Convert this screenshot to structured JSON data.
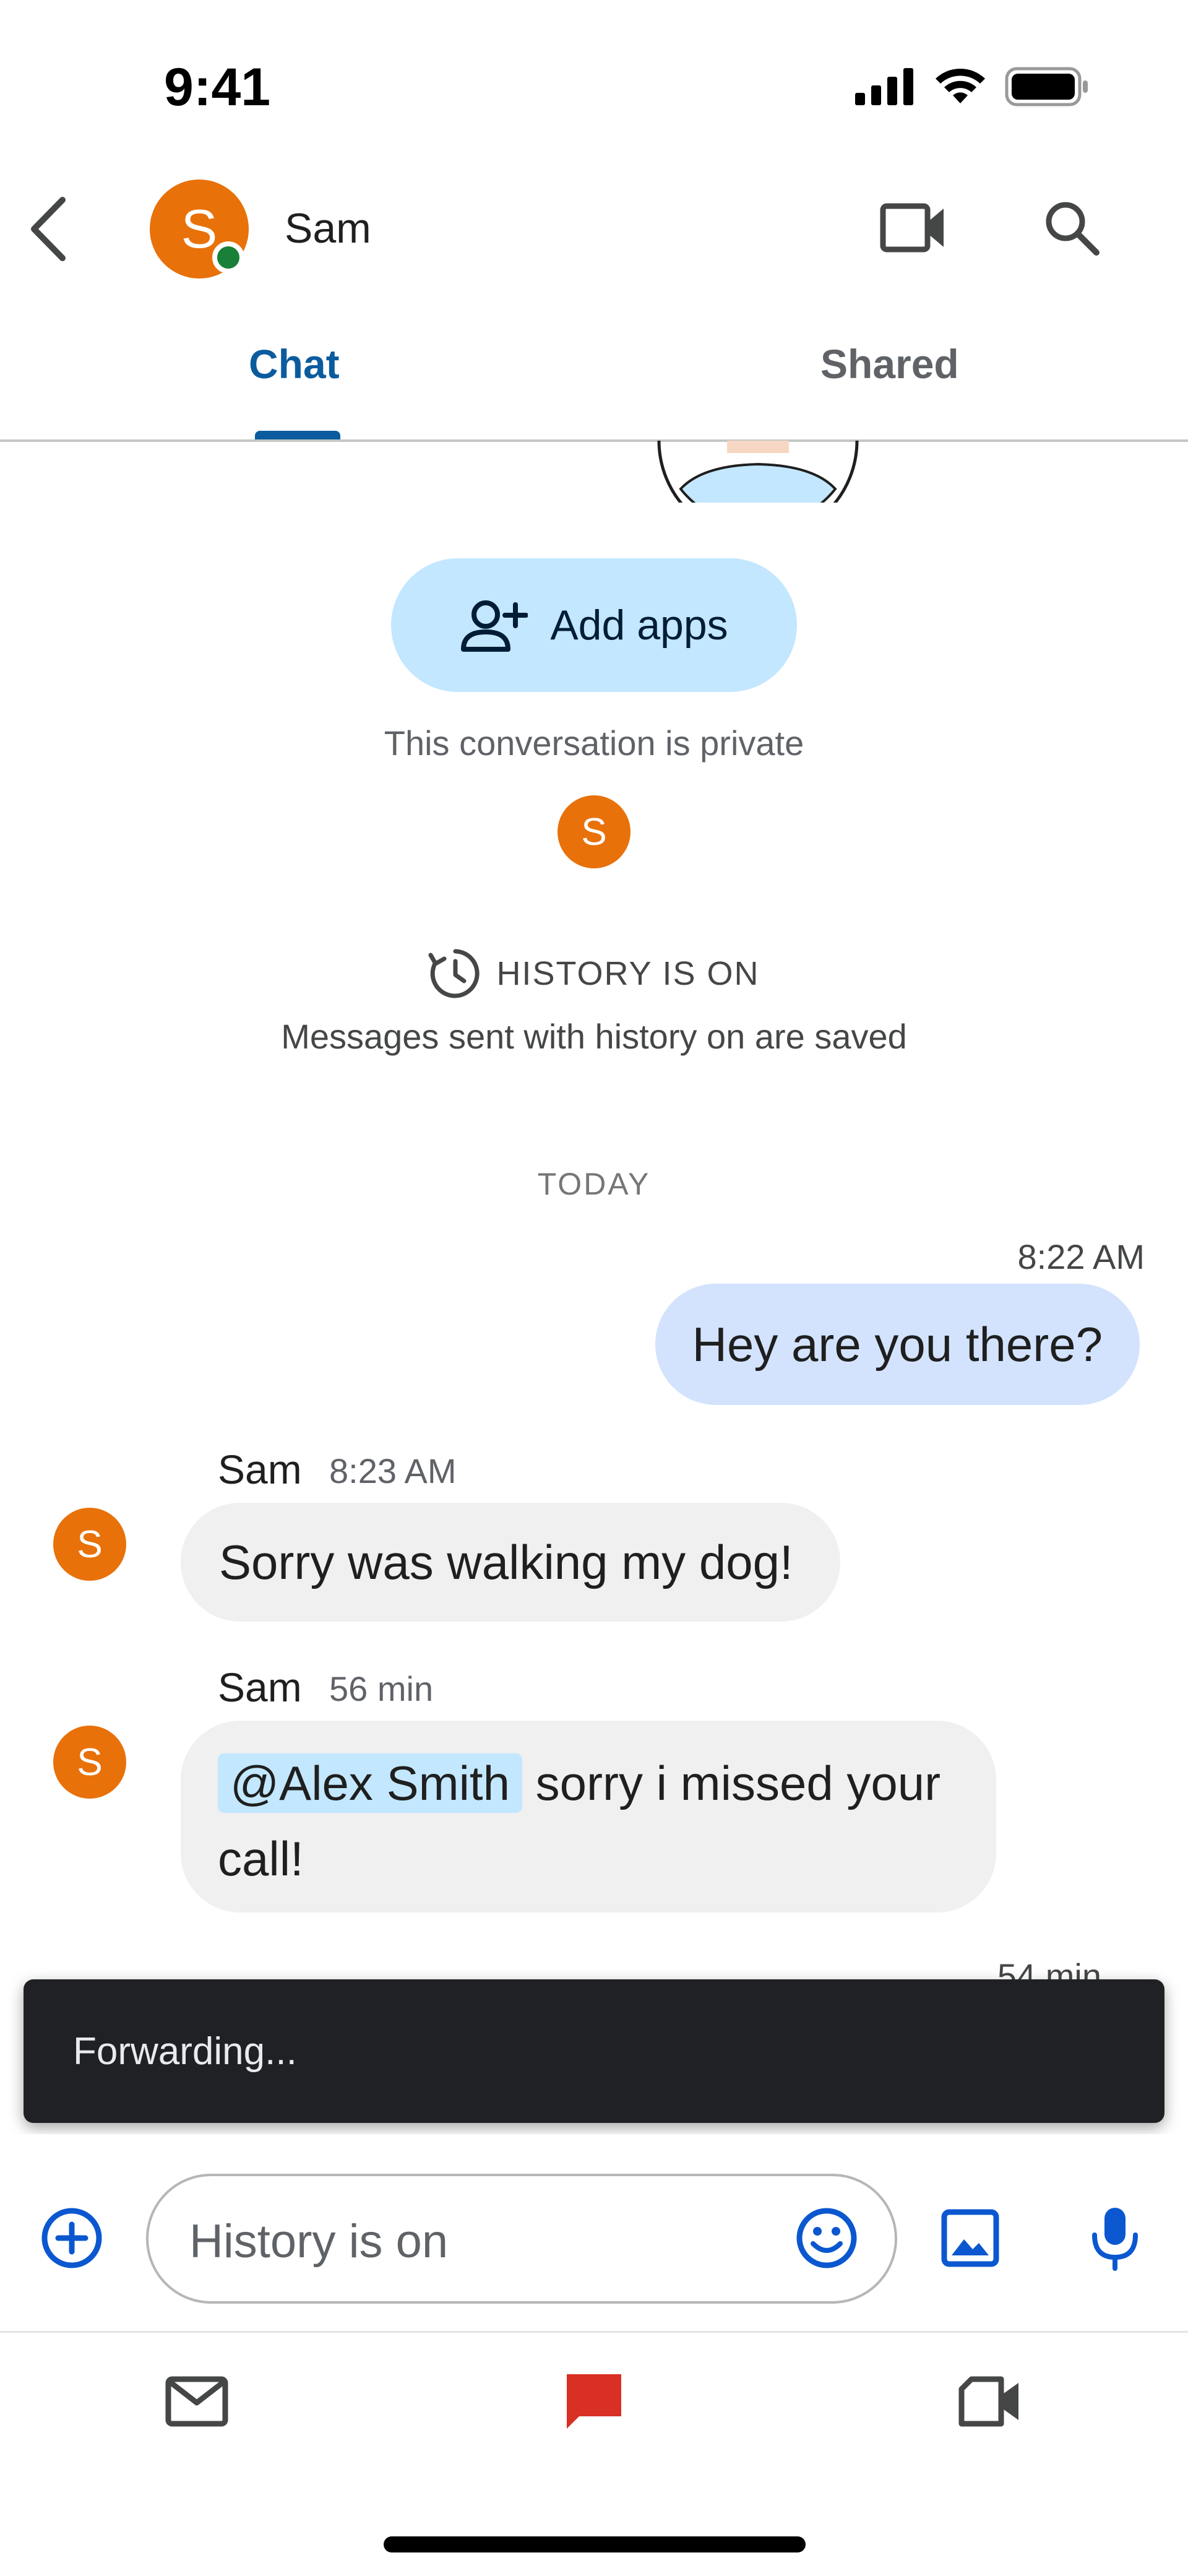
{
  "status_bar": {
    "time": "9:41"
  },
  "header": {
    "contact_name": "Sam",
    "avatar_initial": "S"
  },
  "tabs": [
    {
      "label": "Chat"
    },
    {
      "label": "Shared"
    }
  ],
  "intro": {
    "add_apps_label": "Add apps",
    "private_text": "This conversation is private",
    "member_initial": "S",
    "history_title": "HISTORY IS ON",
    "history_subtitle": "Messages sent with history on are saved"
  },
  "date_divider": "TODAY",
  "messages": [
    {
      "time": "8:22 AM",
      "text": "Hey are you there?"
    },
    {
      "sender": "Sam",
      "time": "8:23 AM",
      "avatar_initial": "S",
      "text": "Sorry was walking my dog!"
    },
    {
      "sender": "Sam",
      "time": "56 min",
      "avatar_initial": "S",
      "mention": "@Alex Smith",
      "text_after_mention": " sorry i missed your",
      "text_line2": "call!"
    }
  ],
  "partial_message_time": "54 min",
  "snackbar": {
    "text": "Forwarding..."
  },
  "composer": {
    "placeholder": "History is on"
  },
  "colors": {
    "accent": "#0b57d0",
    "tab_active": "#0a5c9e",
    "avatar": "#e8710a",
    "online": "#188038",
    "chat_nav_active": "#d93025",
    "outgoing_bubble": "#d3e3fd",
    "incoming_bubble": "#f0f0f0",
    "add_apps_bg": "#c2e7ff"
  },
  "icons": {
    "back": "chevron-left-icon",
    "video": "video-camera-icon",
    "search": "search-icon",
    "add_apps": "person-add-icon",
    "history": "history-icon",
    "add": "plus-circle-icon",
    "emoji": "emoji-icon",
    "gallery": "image-icon",
    "mic": "mic-icon",
    "mail": "mail-icon",
    "chat": "chat-icon",
    "meet": "meet-icon"
  }
}
